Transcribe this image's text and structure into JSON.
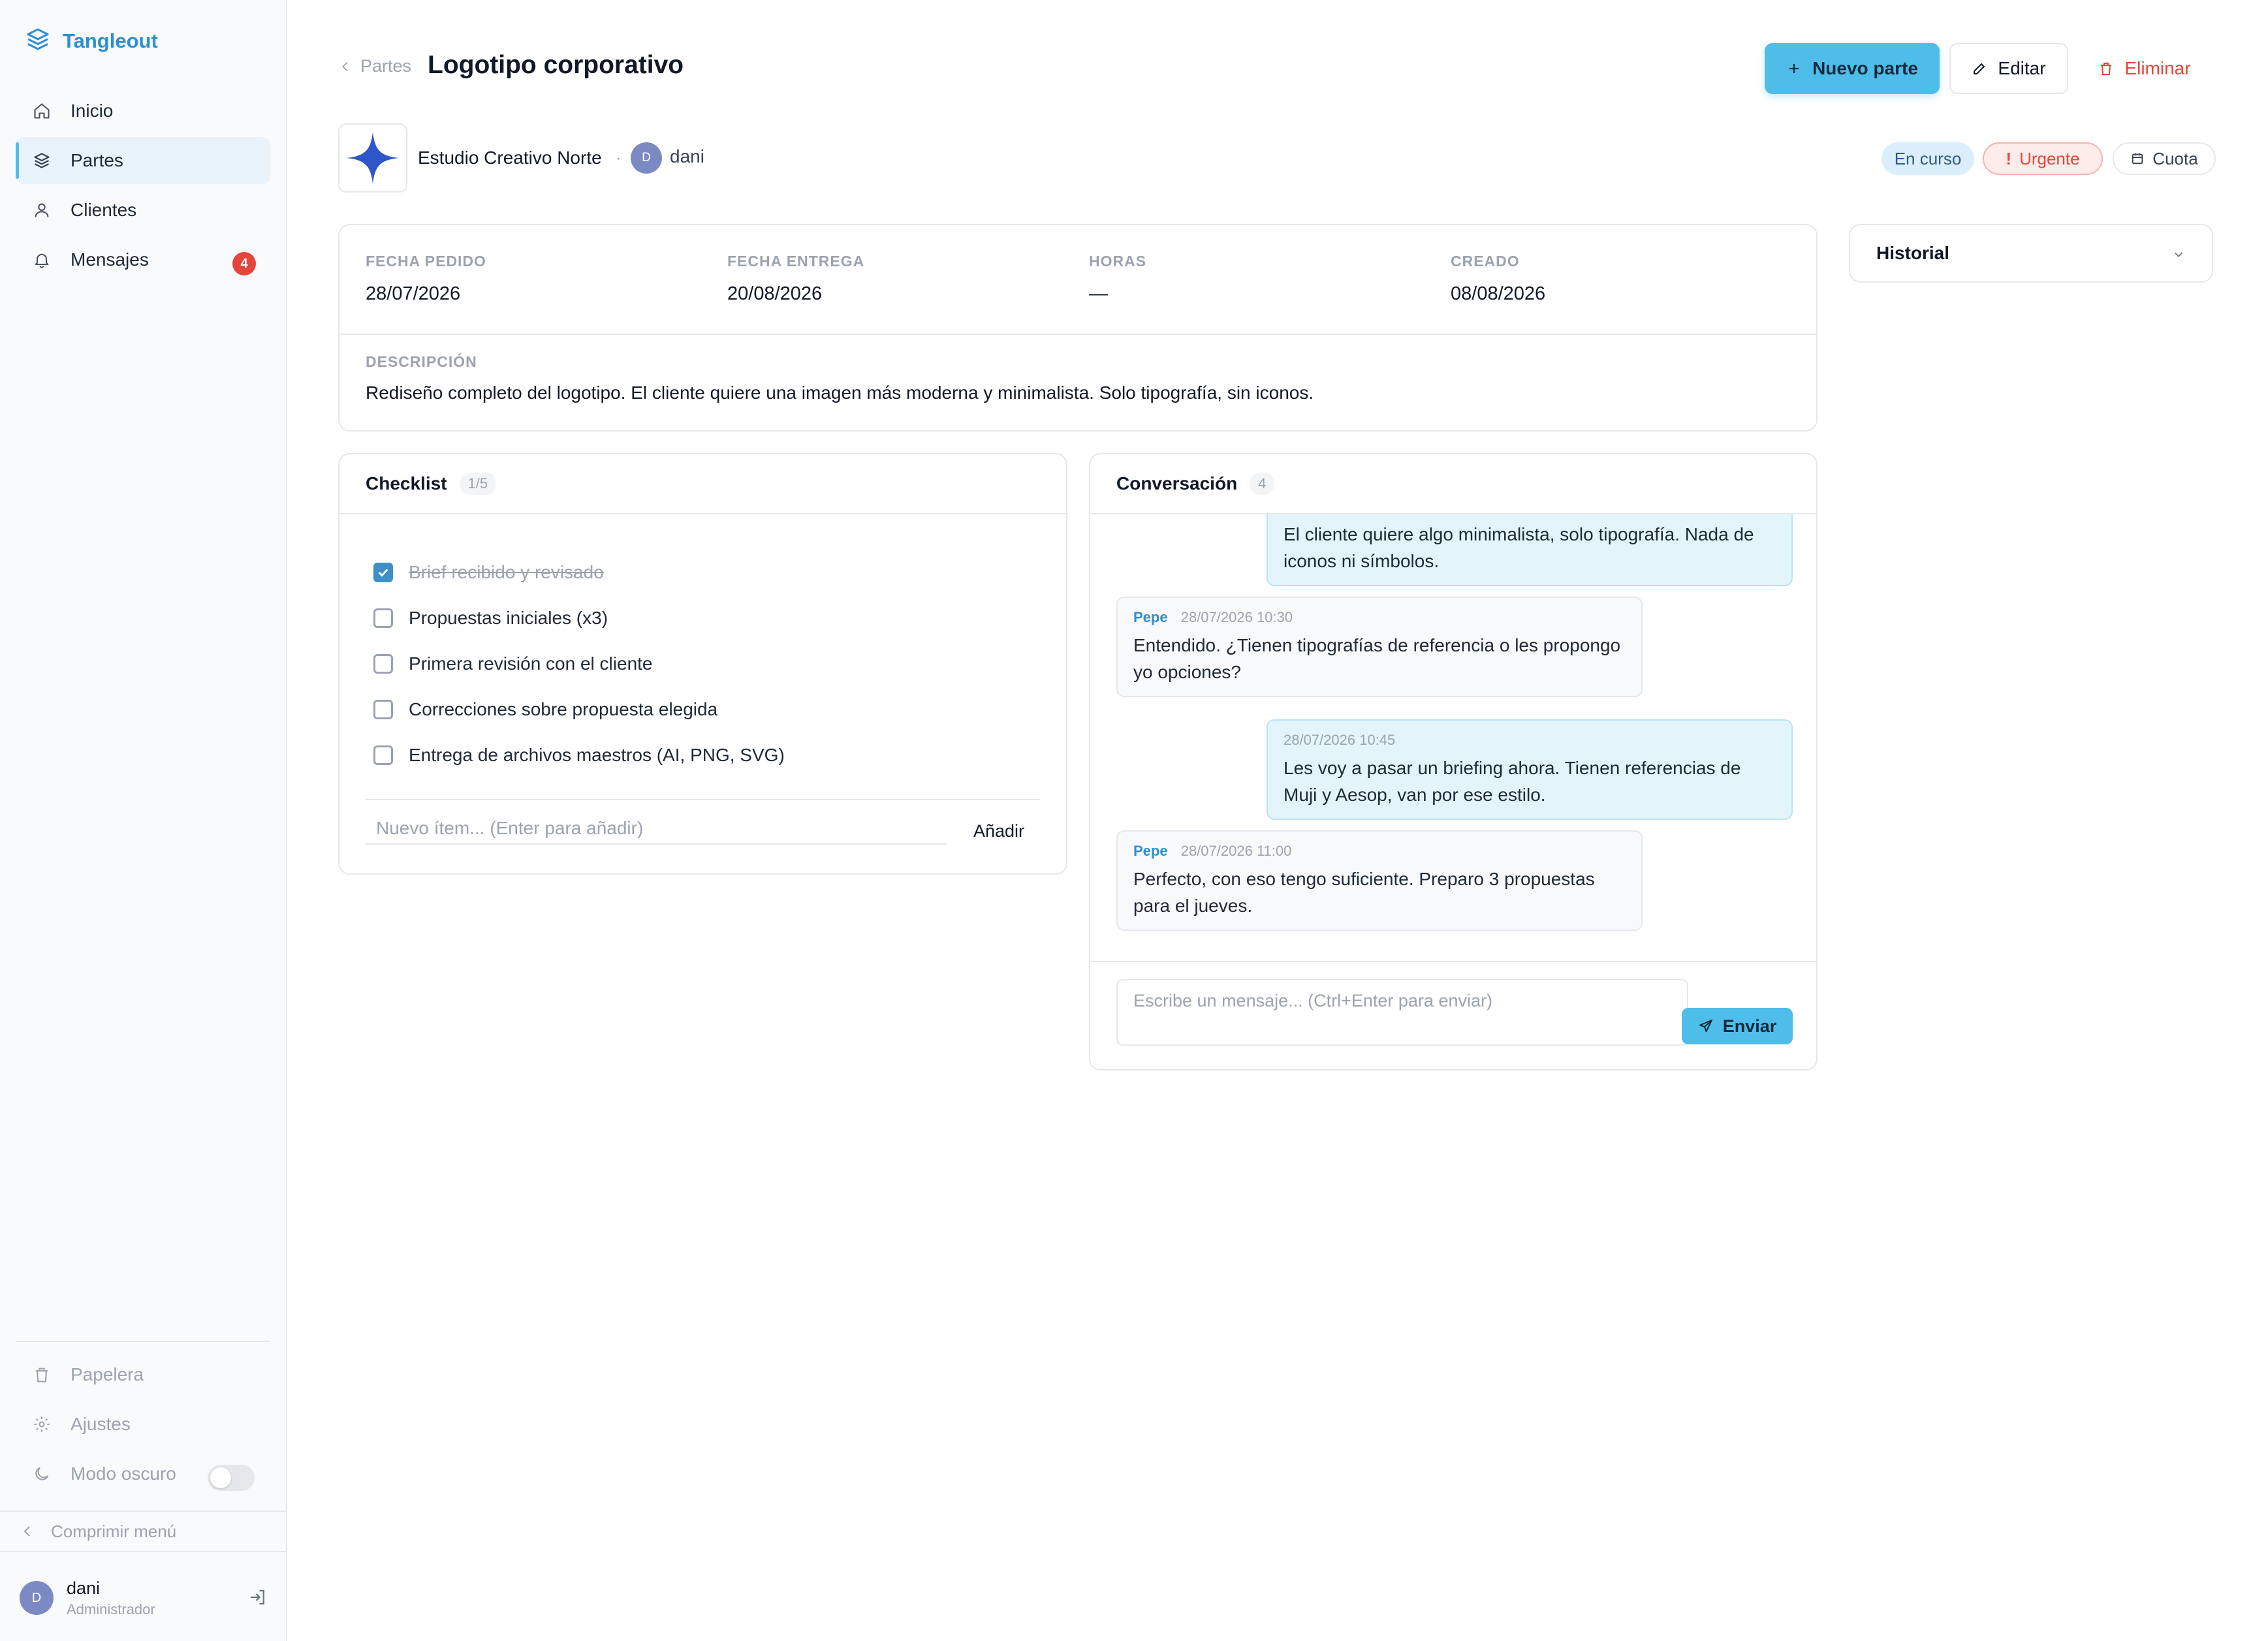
{
  "sidebar": {
    "brand": "Tangleout",
    "items": [
      {
        "label": "Inicio"
      },
      {
        "label": "Partes"
      },
      {
        "label": "Clientes"
      },
      {
        "label": "Mensajes",
        "badge": "4"
      }
    ],
    "bottom_items": [
      {
        "label": "Papelera"
      },
      {
        "label": "Ajustes"
      },
      {
        "label": "Modo oscuro"
      }
    ],
    "collapse_label": "Comprimir menú",
    "user": {
      "initial": "D",
      "name": "dani",
      "role": "Administrador"
    }
  },
  "header": {
    "breadcrumb": "Partes",
    "title": "Logotipo corporativo",
    "new_button": "Nuevo parte",
    "edit_button": "Editar",
    "delete_button": "Eliminar"
  },
  "client": {
    "name": "Estudio Creativo Norte",
    "separator": "·",
    "user_initial": "D",
    "user_name": "dani"
  },
  "tags": {
    "status": "En curso",
    "priority": "Urgente",
    "billing": "Cuota"
  },
  "info": {
    "fields": [
      {
        "label": "FECHA PEDIDO",
        "value": "28/07/2026"
      },
      {
        "label": "FECHA ENTREGA",
        "value": "20/08/2026"
      },
      {
        "label": "HORAS",
        "value": "—"
      },
      {
        "label": "CREADO",
        "value": "08/08/2026"
      }
    ],
    "description_label": "DESCRIPCIÓN",
    "description": "Rediseño completo del logotipo. El cliente quiere una imagen más moderna y minimalista. Solo tipografía, sin iconos."
  },
  "history": {
    "title": "Historial"
  },
  "checklist": {
    "title": "Checklist",
    "count": "1/5",
    "items": [
      {
        "label": "Brief recibido y revisado",
        "done": true
      },
      {
        "label": "Propuestas iniciales (x3)",
        "done": false
      },
      {
        "label": "Primera revisión con el cliente",
        "done": false
      },
      {
        "label": "Correcciones sobre propuesta elegida",
        "done": false
      },
      {
        "label": "Entrega de archivos maestros (AI, PNG, SVG)",
        "done": false
      }
    ],
    "add_placeholder": "Nuevo ítem... (Enter para añadir)",
    "add_button": "Añadir"
  },
  "conversation": {
    "title": "Conversación",
    "count": "4",
    "messages": [
      {
        "text": "El cliente quiere algo minimalista, solo tipografía. Nada de iconos ni símbolos."
      },
      {
        "author": "Pepe",
        "time": "28/07/2026 10:30",
        "text": "Entendido. ¿Tienen tipografías de referencia o les propongo yo opciones?"
      },
      {
        "time": "28/07/2026 10:45",
        "text": "Les voy a pasar un briefing ahora. Tienen referencias de Muji y Aesop, van por ese estilo."
      },
      {
        "author": "Pepe",
        "time": "28/07/2026 11:00",
        "text": "Perfecto, con eso tengo suficiente. Preparo 3 propuestas para el jueves."
      }
    ],
    "input_placeholder": "Escribe un mensaje... (Ctrl+Enter para enviar)",
    "send_button": "Enviar"
  },
  "colors": {
    "accent": "#4fbde9",
    "brand": "#2d8fd1",
    "danger": "#e5453b",
    "status_bg": "#dbeefb"
  },
  "icons": [
    "layers-icon",
    "home-icon",
    "layers-icon",
    "user-icon",
    "bell-icon",
    "trash-icon",
    "gear-icon",
    "moon-icon",
    "chevron-left-icon",
    "logout-icon",
    "plus-icon",
    "pencil-icon",
    "trash-icon",
    "calendar-icon",
    "chevron-down-icon",
    "send-icon",
    "check-icon",
    "sparkle-logo"
  ]
}
